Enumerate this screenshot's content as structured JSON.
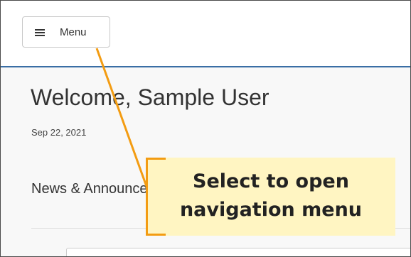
{
  "toolbar": {
    "menu_label": "Menu",
    "menu_icon": "hamburger-icon"
  },
  "main": {
    "welcome_title": "Welcome, Sample User",
    "date": "Sep 22, 2021",
    "news_heading": "News & Announcements"
  },
  "callout": {
    "line1": "Select to open",
    "line2": "navigation menu"
  },
  "colors": {
    "accent_border": "#3a6ea5",
    "callout_bg": "#fff5c2",
    "callout_accent": "#f39c12"
  }
}
